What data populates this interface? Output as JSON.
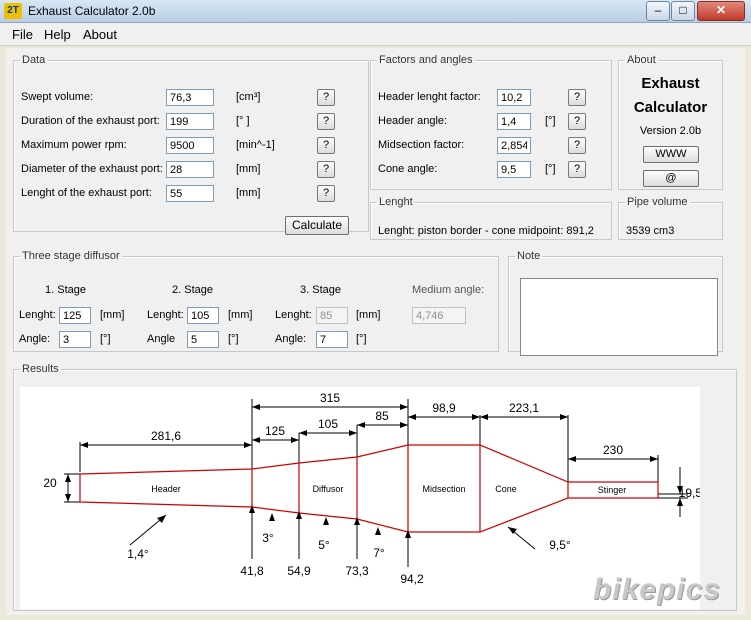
{
  "window": {
    "app_icon": "2T",
    "title": "Exhaust Calculator 2.0b",
    "minimize": "–",
    "maximize": "□",
    "close": "✕"
  },
  "menu": [
    "File",
    "Help",
    "About"
  ],
  "data_group": {
    "legend": "Data",
    "rows": [
      {
        "label": "Swept volume:",
        "value": "76,3",
        "unit": "[cm³]",
        "help": "?"
      },
      {
        "label": "Duration of the exhaust port:",
        "value": "199",
        "unit": "[° ]",
        "help": "?"
      },
      {
        "label": "Maximum power rpm:",
        "value": "9500",
        "unit": "[min^-1]",
        "help": "?"
      },
      {
        "label": "Diameter of the exhaust port:",
        "value": "28",
        "unit": "[mm]",
        "help": "?"
      },
      {
        "label": "Lenght of the exhaust port:",
        "value": "55",
        "unit": "[mm]",
        "help": "?"
      }
    ],
    "calculate": "Calculate"
  },
  "factors_group": {
    "legend": "Factors and angles",
    "rows": [
      {
        "label": "Header lenght factor:",
        "value": "10,2",
        "unit": "",
        "help": "?"
      },
      {
        "label": "Header angle:",
        "value": "1,4",
        "unit": "[°]",
        "help": "?"
      },
      {
        "label": "Midsection factor:",
        "value": "2,854",
        "unit": "",
        "help": "?"
      },
      {
        "label": "Cone angle:",
        "value": "9,5",
        "unit": "[°]",
        "help": "?"
      }
    ]
  },
  "about_group": {
    "legend": "About",
    "name_line1": "Exhaust",
    "name_line2": "Calculator",
    "version": "Version 2.0b",
    "www": "WWW",
    "at": "@"
  },
  "length_group": {
    "legend": "Lenght",
    "text": "Lenght: piston border - cone midpoint:  891,2"
  },
  "pipe_group": {
    "legend": "Pipe volume",
    "text": "3539 cm3"
  },
  "diffusor_group": {
    "legend": "Three stage diffusor",
    "stages": [
      {
        "title": "1. Stage",
        "lenght_label": "Lenght:",
        "lenght": "125",
        "lenght_unit": "[mm]",
        "angle_label": "Angle:",
        "angle": "3",
        "angle_unit": "[°]",
        "disabled": false
      },
      {
        "title": "2. Stage",
        "lenght_label": "Lenght:",
        "lenght": "105",
        "lenght_unit": "[mm]",
        "angle_label": "Angle",
        "angle": "5",
        "angle_unit": "[°]",
        "disabled": false
      },
      {
        "title": "3. Stage",
        "lenght_label": "Lenght:",
        "lenght": "85",
        "lenght_unit": "[mm]",
        "angle_label": "Angle:",
        "angle": "7",
        "angle_unit": "[°]",
        "disabled": true
      }
    ],
    "medium_angle_label": "Medium angle:",
    "medium_angle": "4,746"
  },
  "note_group": {
    "legend": "Note",
    "text": ""
  },
  "results": {
    "legend": "Results",
    "segments": [
      "Header",
      "Diffusor",
      "Midsection",
      "Cone",
      "Stinger"
    ],
    "top_dims": [
      "315",
      "281,6",
      "125",
      "105",
      "85",
      "98,9",
      "223,1",
      "230"
    ],
    "left_diameter": "20",
    "right_diameter": "19,5",
    "diameters_bottom": [
      "41,8",
      "54,9",
      "73,3",
      "94,2"
    ],
    "angles": [
      "1,4°",
      "3°",
      "5°",
      "7°",
      "9,5°"
    ],
    "colors": {
      "pipe": "#cc0000",
      "dim": "#000000"
    }
  },
  "watermark": "bikepics"
}
